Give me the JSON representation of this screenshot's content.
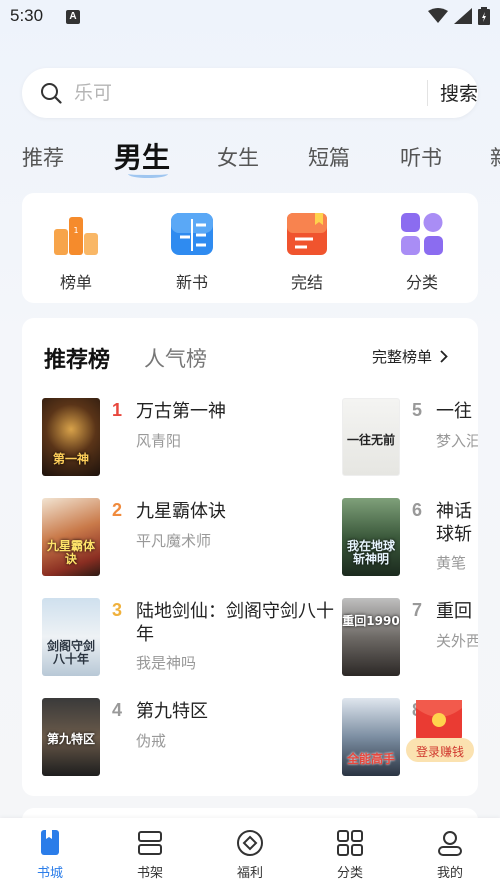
{
  "status": {
    "time": "5:30",
    "app_badge": "A"
  },
  "search": {
    "placeholder": "乐可",
    "button": "搜索"
  },
  "tabs": [
    "推荐",
    "男生",
    "女生",
    "短篇",
    "听书",
    "新"
  ],
  "quick": [
    "榜单",
    "新书",
    "完结",
    "分类"
  ],
  "ranking": {
    "tab_active": "推荐榜",
    "tab_other": "人气榜",
    "more": "完整榜单",
    "books": [
      {
        "rank": "1",
        "title": "万古第一神",
        "author": "风青阳",
        "cover_text": "第一神"
      },
      {
        "rank": "2",
        "title": "九星霸体诀",
        "author": "平凡魔术师",
        "cover_text": "九星霸体诀"
      },
      {
        "rank": "3",
        "title": "陆地剑仙：剑阁守剑八十年",
        "author": "我是神吗",
        "cover_text": "剑阁守剑八十年"
      },
      {
        "rank": "4",
        "title": "第九特区",
        "author": "伪戒",
        "cover_text": "第九特区"
      },
      {
        "rank": "5",
        "title": "一往",
        "author": "梦入汩",
        "cover_text": "一往无前"
      },
      {
        "rank": "6",
        "title": "神话球斩",
        "author": "黄笔",
        "cover_text": "我在地球斩神明"
      },
      {
        "rank": "7",
        "title": "重回",
        "author": "关外西",
        "cover_text": "重回1990"
      },
      {
        "rank": "8",
        "title": "园",
        "author": "狱",
        "cover_text": "全能高手"
      }
    ]
  },
  "float_badge": {
    "label": "登录赚钱"
  },
  "nav": [
    "书城",
    "书架",
    "福利",
    "分类",
    "我的"
  ],
  "colors": {
    "accent": "#2b7de9",
    "rank1": "#e8473d",
    "rank2": "#f08a3c",
    "rank3": "#f0b13c",
    "rank_other": "#999999"
  }
}
